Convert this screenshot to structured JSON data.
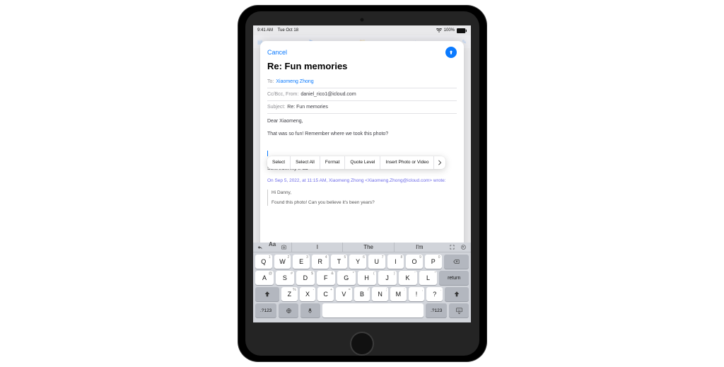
{
  "status": {
    "time": "9:41 AM",
    "date": "Tue Oct 18",
    "battery": "100%"
  },
  "compose": {
    "cancel": "Cancel",
    "title": "Re: Fun memories",
    "to_label": "To:",
    "to_value": "Xiaomeng Zhong",
    "ccfrom_label": "Cc/Bcc, From:",
    "ccfrom_value": "daniel_rico1@icloud.com",
    "subject_label": "Subject:",
    "subject_value": "Re: Fun memories",
    "greeting": "Dear Xiaomeng,",
    "line1": "That was so fun! Remember where we took this photo?",
    "signature": "Sent from my iPad",
    "quote_header": "On Sep 5, 2022, at 11:15 AM, Xiaomeng Zhong <Xiaomeng.Zhong@icloud.com> wrote:",
    "quote_greet": "Hi Danny,",
    "quote_body": "Found this photo! Can you believe it's been years?"
  },
  "context_menu": {
    "select": "Select",
    "select_all": "Select All",
    "format": "Format",
    "quote": "Quote Level",
    "insert": "Insert Photo or Video"
  },
  "keyboard": {
    "sug1": "I",
    "sug2": "The",
    "sug3": "I'm",
    "row1": [
      "Q",
      "W",
      "E",
      "R",
      "T",
      "Y",
      "U",
      "I",
      "O",
      "P"
    ],
    "row1_alt": [
      "1",
      "2",
      "3",
      "4",
      "5",
      "6",
      "7",
      "8",
      "9",
      "0"
    ],
    "row2": [
      "A",
      "S",
      "D",
      "F",
      "G",
      "H",
      "J",
      "K",
      "L"
    ],
    "row2_alt": [
      "@",
      "#",
      "$",
      "&",
      "*",
      "(",
      ")",
      "'",
      "\""
    ],
    "row3": [
      "Z",
      "X",
      "C",
      "V",
      "B",
      "N",
      "M"
    ],
    "row3_alt": [
      "%",
      "-",
      "+",
      "=",
      "/",
      ";",
      ":"
    ],
    "return": "return",
    "numkey": ".?123",
    "punct1": "!",
    "punct1_alt": ",",
    "punct2": "?",
    "punct2_alt": "."
  }
}
